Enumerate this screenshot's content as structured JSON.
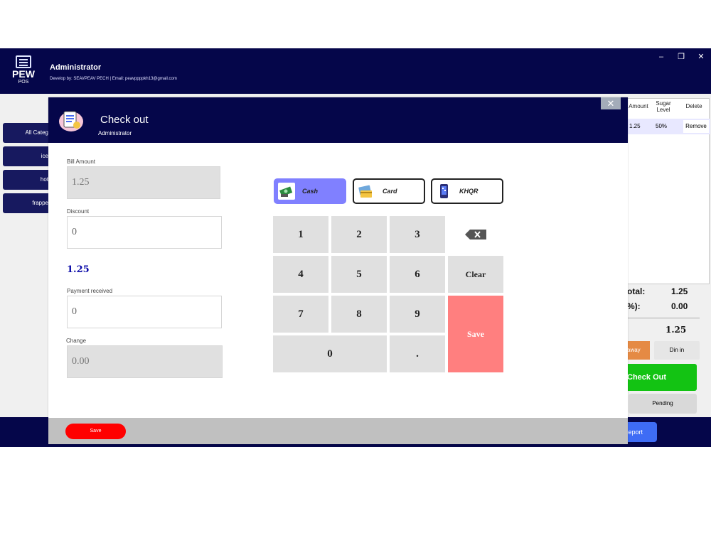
{
  "app": {
    "logo_big": "PEW",
    "logo_small": "POS",
    "title": "Administrator",
    "subtitle": "Develop by: SEAVPEAV PECH | Email: peavppppkh13@gmail.com",
    "window_controls": {
      "minimize": "–",
      "restore": "❐",
      "close": "✕"
    }
  },
  "categories": [
    {
      "label": "All Categ"
    },
    {
      "label": "ice"
    },
    {
      "label": "hot"
    },
    {
      "label": "frappe"
    }
  ],
  "cart": {
    "headers": {
      "amount": "Amount",
      "sugar": "Sugar Level",
      "delete": "Delete"
    },
    "rows": [
      {
        "amount": "1.25",
        "sugar": "50%",
        "action": "Remove"
      }
    ],
    "subtotal_label": "otal:",
    "subtotal_value": "1.25",
    "discount_label": "%):",
    "discount_value": "0.00",
    "grand_total": "1.25",
    "takeaway_label": "away",
    "dinein_label": "Din in",
    "checkout_label": "Check Out",
    "pending_label": "Pending",
    "report_label": "eport"
  },
  "modal": {
    "title": "Check out",
    "subtitle": "Administrator",
    "close": "✕",
    "bill_amount_label": "Bill Amount",
    "bill_amount": "1.25",
    "discount_label": "Discount",
    "discount": "0",
    "net_total": "1.25",
    "payment_label": "Payment received",
    "payment": "0",
    "change_label": "Change",
    "change": "0.00",
    "payment_methods": [
      {
        "label": "Cash",
        "icon": "cash-icon",
        "active": true
      },
      {
        "label": "Card",
        "icon": "card-icon",
        "active": false
      },
      {
        "label": "KHQR",
        "icon": "qr-phone-icon",
        "active": false
      }
    ],
    "keypad": {
      "k1": "1",
      "k2": "2",
      "k3": "3",
      "k4": "4",
      "k5": "5",
      "k6": "6",
      "k7": "7",
      "k8": "8",
      "k9": "9",
      "k0": "0",
      "dot": ".",
      "clear": "Clear",
      "save": "Save",
      "backspace_icon": "backspace-icon"
    },
    "footer_save": "Save"
  },
  "colors": {
    "navy": "#05064a",
    "accent_purple": "#8080ff",
    "save_pink": "#ff7f7f",
    "checkout_green": "#13c313",
    "footer_red": "#ff0000"
  }
}
